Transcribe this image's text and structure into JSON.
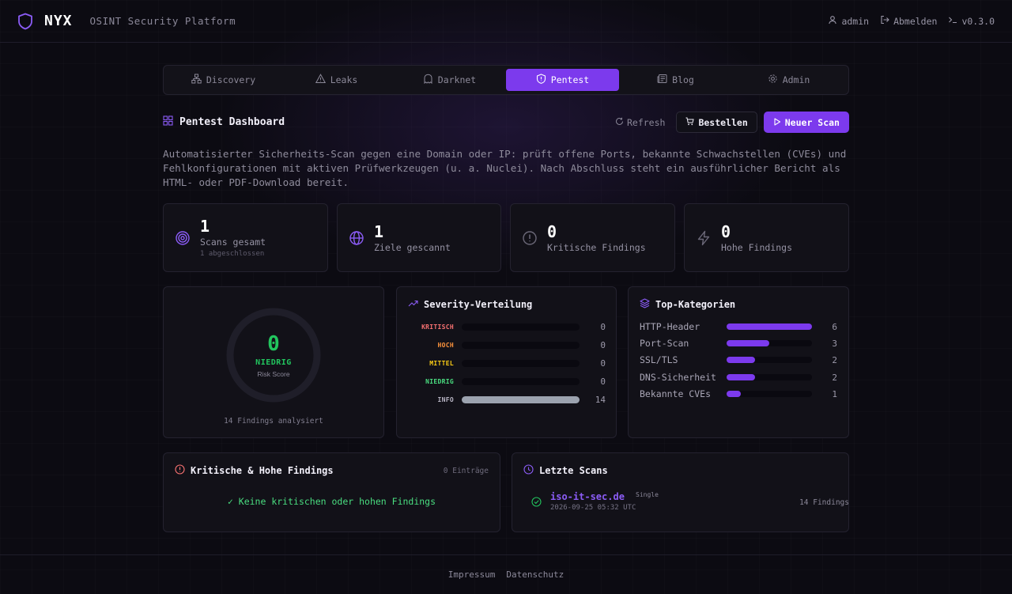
{
  "header": {
    "brand": "NYX",
    "subtitle": "OSINT Security Platform",
    "user": "admin",
    "logout": "Abmelden",
    "version": "v0.3.0"
  },
  "tabs": [
    {
      "label": "Discovery",
      "icon": "network-icon",
      "active": false
    },
    {
      "label": "Leaks",
      "icon": "warning-icon",
      "active": false
    },
    {
      "label": "Darknet",
      "icon": "ghost-icon",
      "active": false
    },
    {
      "label": "Pentest",
      "icon": "shield-alert-icon",
      "active": true
    },
    {
      "label": "Blog",
      "icon": "newspaper-icon",
      "active": false
    },
    {
      "label": "Admin",
      "icon": "gear-icon",
      "active": false
    }
  ],
  "page": {
    "title": "Pentest Dashboard",
    "refresh": "Refresh",
    "order": "Bestellen",
    "new_scan": "Neuer Scan",
    "description": "Automatisierter Sicherheits-Scan gegen eine Domain oder IP: prüft offene Ports, bekannte Schwachstellen (CVEs) und Fehlkonfigurationen mit aktiven Prüfwerkzeugen (u. a. Nuclei). Nach Abschluss steht ein ausführlicher Bericht als HTML- oder PDF-Download bereit."
  },
  "stats": [
    {
      "value": "1",
      "label": "Scans gesamt",
      "sub": "1 abgeschlossen",
      "icon": "target-icon"
    },
    {
      "value": "1",
      "label": "Ziele gescannt",
      "sub": "",
      "icon": "globe-icon"
    },
    {
      "value": "0",
      "label": "Kritische Findings",
      "sub": "",
      "icon": "alert-circle-icon"
    },
    {
      "value": "0",
      "label": "Hohe Findings",
      "sub": "",
      "icon": "lightning-icon"
    }
  ],
  "risk": {
    "score": "0",
    "level": "NIEDRIG",
    "label": "Risk Score",
    "footer": "14 Findings analysiert"
  },
  "severity": {
    "title": "Severity-Verteilung",
    "max": 14,
    "rows": [
      {
        "label": "KRITISCH",
        "count": 0,
        "color": "#f87171"
      },
      {
        "label": "HOCH",
        "count": 0,
        "color": "#fb923c"
      },
      {
        "label": "MITTEL",
        "count": 0,
        "color": "#facc15"
      },
      {
        "label": "NIEDRIG",
        "count": 0,
        "color": "#4ade80"
      },
      {
        "label": "INFO",
        "count": 14,
        "color": "#9ca3af"
      }
    ]
  },
  "categories": {
    "title": "Top-Kategorien",
    "max": 6,
    "rows": [
      {
        "label": "HTTP-Header",
        "count": 6
      },
      {
        "label": "Port-Scan",
        "count": 3
      },
      {
        "label": "SSL/TLS",
        "count": 2
      },
      {
        "label": "DNS-Sicherheit",
        "count": 2
      },
      {
        "label": "Bekannte CVEs",
        "count": 1
      }
    ]
  },
  "critical": {
    "title": "Kritische & Hohe Findings",
    "entries": "0 Einträge",
    "empty": "✓ Keine kritischen oder hohen Findings"
  },
  "recent": {
    "title": "Letzte Scans",
    "scans": [
      {
        "domain": "iso-it-sec.de",
        "mode": "Single",
        "date": "2026-09-25 05:32 UTC",
        "findings": "14 Findings"
      }
    ]
  },
  "footer": {
    "impressum": "Impressum",
    "datenschutz": "Datenschutz"
  },
  "colors": {
    "accent": "#7c3aed",
    "success": "#22c55e"
  }
}
